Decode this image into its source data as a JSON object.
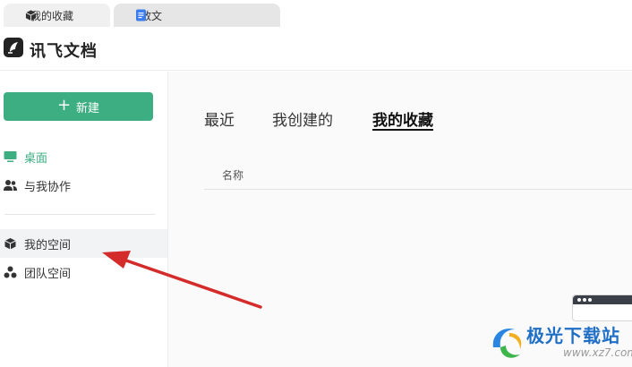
{
  "browser_tabs": [
    {
      "label": "我的收藏",
      "icon": "cube-icon",
      "active": true
    },
    {
      "label": "散文",
      "icon": "document-icon",
      "active": false
    }
  ],
  "header": {
    "brand": "讯飞文档",
    "logo_icon": "iflytek-logo-icon"
  },
  "sidebar": {
    "new_button": {
      "label": "新建",
      "icon": "plus-icon"
    },
    "items": [
      {
        "label": "桌面",
        "icon": "monitor-icon",
        "active": true
      },
      {
        "label": "与我协作",
        "icon": "users-icon",
        "active": false
      },
      {
        "label": "我的空间",
        "icon": "cube-icon",
        "active": false,
        "highlighted": true
      },
      {
        "label": "团队空间",
        "icon": "team-nodes-icon",
        "active": false
      }
    ]
  },
  "main": {
    "tabs": [
      {
        "label": "最近",
        "selected": false
      },
      {
        "label": "我创建的",
        "selected": false
      },
      {
        "label": "我的收藏",
        "selected": true
      }
    ],
    "table_columns": [
      "名称"
    ]
  },
  "watermark": {
    "text": "极光下载站",
    "url": "www.xz7.com"
  },
  "colors": {
    "accent": "#3dae82",
    "annotation_arrow": "#d42b2b",
    "watermark_blue": "#1f6fc6"
  }
}
